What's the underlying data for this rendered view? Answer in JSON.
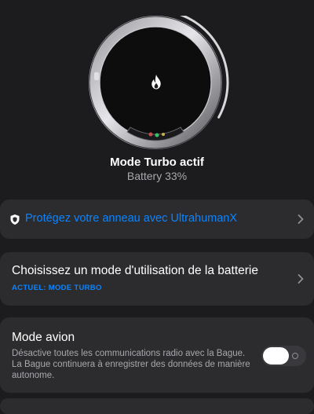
{
  "status": {
    "title": "Mode Turbo actif",
    "battery": "Battery 33%",
    "battery_level": 0.33,
    "icon": "flame-icon"
  },
  "protect": {
    "label": "Protégez votre anneau avec UltrahumanX",
    "icon": "shield-icon"
  },
  "battery_mode": {
    "title": "Choisissez un mode d'utilisation de la batterie",
    "current": "ACTUEL: MODE TURBO"
  },
  "airplane": {
    "title": "Mode avion",
    "description": "Désactive toutes les communications radio avec la Bague. La Bague continuera à enregistrer des données de manière autonome.",
    "enabled": false
  },
  "colors": {
    "background": "#1c1c1e",
    "card": "#2c2c2e",
    "accent": "#0a84ff",
    "secondary_text": "#a8a8ad"
  }
}
